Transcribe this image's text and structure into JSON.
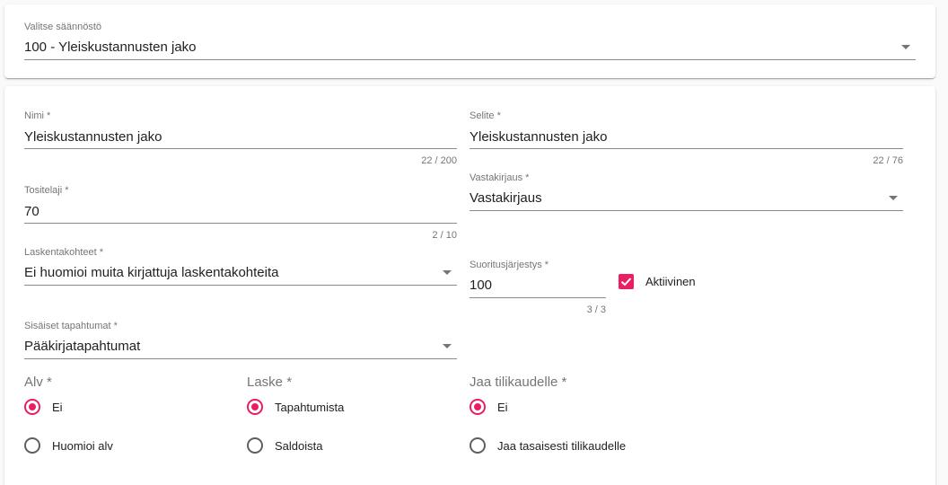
{
  "ruleset": {
    "label": "Valitse säännöstö",
    "value": "100 - Yleiskustannusten jako"
  },
  "form": {
    "nimi": {
      "label": "Nimi *",
      "value": "Yleiskustannusten jako",
      "counter": "22 / 200"
    },
    "selite": {
      "label": "Selite *",
      "value": "Yleiskustannusten jako",
      "counter": "22 / 76"
    },
    "tositelaji": {
      "label": "Tositelaji *",
      "value": "70",
      "counter": "2 / 10"
    },
    "vastakirjaus": {
      "label": "Vastakirjaus *",
      "value": "Vastakirjaus"
    },
    "laskentakohteet": {
      "label": "Laskentakohteet *",
      "value": "Ei huomioi muita kirjattuja laskentakohteita"
    },
    "suoritusjarjestys": {
      "label": "Suoritusjärjestys *",
      "value": "100",
      "counter": "3 / 3"
    },
    "aktiivinen": {
      "label": "Aktiivinen",
      "checked": true
    },
    "sisaiset": {
      "label": "Sisäiset tapahtumat *",
      "value": "Pääkirjatapahtumat"
    },
    "alv": {
      "title": "Alv *",
      "options": [
        "Ei",
        "Huomioi alv"
      ],
      "selected": 0
    },
    "laske": {
      "title": "Laske *",
      "options": [
        "Tapahtumista",
        "Saldoista"
      ],
      "selected": 0
    },
    "jaa": {
      "title": "Jaa tilikaudelle *",
      "options": [
        "Ei",
        "Jaa tasaisesti tilikaudelle"
      ],
      "selected": 0
    }
  },
  "colors": {
    "accent": "#e91e63",
    "line": "#8a8a8a",
    "label": "#757575"
  }
}
